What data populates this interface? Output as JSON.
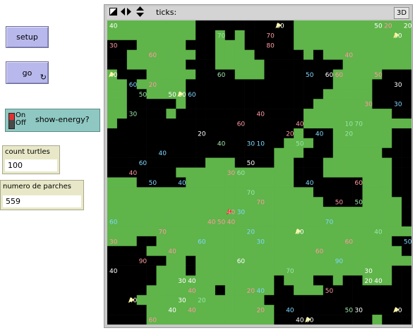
{
  "buttons": {
    "setup_label": "setup",
    "go_label": "go",
    "go_icon": "forever-arrows-icon"
  },
  "switch": {
    "on_label": "On",
    "off_label": "Off",
    "label": "show-energy?",
    "state": "off"
  },
  "monitors": [
    {
      "label": "count turtles",
      "value": "100"
    },
    {
      "label": "numero de parches",
      "value": "559"
    }
  ],
  "view": {
    "ticks_label": "ticks:",
    "ticks_value": "",
    "three_d_label": "3D",
    "world": {
      "grid_cols": 31,
      "grid_rows": 31,
      "green_patches": 559,
      "patch_colors": {
        "grass": "#5fb44a",
        "dirt": "#000000"
      },
      "turtles": [
        {
          "c": 0,
          "r": 0,
          "label": "40",
          "color": "#ffffff"
        },
        {
          "c": 17,
          "r": 0,
          "label": "80",
          "color": "#ffffff",
          "sheep": true
        },
        {
          "c": 27,
          "r": 0,
          "label": "50",
          "color": "#ffffff"
        },
        {
          "c": 28,
          "r": 0,
          "label": "20",
          "color": "#ff9aa2"
        },
        {
          "c": 30,
          "r": 0,
          "label": "20",
          "color": "#ffffff"
        },
        {
          "c": 0,
          "r": 2,
          "label": "30",
          "color": "#ff9aa2"
        },
        {
          "c": 11,
          "r": 1,
          "label": "70",
          "color": "#9ae6a8"
        },
        {
          "c": 16,
          "r": 1,
          "label": "70",
          "color": "#ff9aa2"
        },
        {
          "c": 16,
          "r": 2,
          "label": "80",
          "color": "#ff9aa2"
        },
        {
          "c": 29,
          "r": 1,
          "label": "30",
          "color": "#ffffff",
          "sheep": true
        },
        {
          "c": 4,
          "r": 3,
          "label": "60",
          "color": "#ff9aa2"
        },
        {
          "c": 24,
          "r": 3,
          "label": "40",
          "color": "#ff9aa2"
        },
        {
          "c": 0,
          "r": 5,
          "label": "40",
          "color": "#ffffff",
          "sheep": true
        },
        {
          "c": 11,
          "r": 5,
          "label": "60",
          "color": "#9ae6a8"
        },
        {
          "c": 20,
          "r": 5,
          "label": "50",
          "color": "#7fd8ff"
        },
        {
          "c": 22,
          "r": 5,
          "label": "60",
          "color": "#ffffff"
        },
        {
          "c": 23,
          "r": 5,
          "label": "60",
          "color": "#ff9aa2"
        },
        {
          "c": 27,
          "r": 5,
          "label": "50",
          "color": "#ff9aa2"
        },
        {
          "c": 2,
          "r": 6,
          "label": "60",
          "color": "#7fd8ff"
        },
        {
          "c": 4,
          "r": 6,
          "label": "20",
          "color": "#ff9aa2"
        },
        {
          "c": 29,
          "r": 6,
          "label": "30",
          "color": "#ffffff"
        },
        {
          "c": 3,
          "r": 7,
          "label": "50",
          "color": "#9ae6a8"
        },
        {
          "c": 6,
          "r": 7,
          "label": "50",
          "color": "#ffffff"
        },
        {
          "c": 7,
          "r": 7,
          "label": "80",
          "color": "#ffffff",
          "sheep": true
        },
        {
          "c": 8,
          "r": 7,
          "label": "60",
          "color": "#7fd8ff"
        },
        {
          "c": 26,
          "r": 8,
          "label": "30",
          "color": "#ff9aa2"
        },
        {
          "c": 29,
          "r": 8,
          "label": "30",
          "color": "#7fd8ff"
        },
        {
          "c": 2,
          "r": 9,
          "label": "30",
          "color": "#9ae6a8"
        },
        {
          "c": 15,
          "r": 9,
          "label": "40",
          "color": "#ff9aa2"
        },
        {
          "c": 13,
          "r": 10,
          "label": "60",
          "color": "#ff9aa2"
        },
        {
          "c": 9,
          "r": 11,
          "label": "20",
          "color": "#ffffff"
        },
        {
          "c": 19,
          "r": 10,
          "label": "40",
          "color": "#ff9aa2"
        },
        {
          "c": 18,
          "r": 11,
          "label": "20",
          "color": "#ff9aa2"
        },
        {
          "c": 21,
          "r": 11,
          "label": "40",
          "color": "#7fd8ff"
        },
        {
          "c": 24,
          "r": 10,
          "label": "10",
          "color": "#9ae6a8"
        },
        {
          "c": 25,
          "r": 10,
          "label": "70",
          "color": "#9ae6a8"
        },
        {
          "c": 24,
          "r": 11,
          "label": "20",
          "color": "#9ae6a8"
        },
        {
          "c": 11,
          "r": 12,
          "label": "40",
          "color": "#9ae6a8"
        },
        {
          "c": 14,
          "r": 12,
          "label": "30",
          "color": "#7fd8ff"
        },
        {
          "c": 15,
          "r": 12,
          "label": "10",
          "color": "#7fd8ff"
        },
        {
          "c": 19,
          "r": 12,
          "label": "50",
          "color": "#9ae6a8"
        },
        {
          "c": 5,
          "r": 13,
          "label": "40",
          "color": "#7fd8ff"
        },
        {
          "c": 14,
          "r": 14,
          "label": "50",
          "color": "#ffffff"
        },
        {
          "c": 3,
          "r": 14,
          "label": "60",
          "color": "#7fd8ff"
        },
        {
          "c": 12,
          "r": 15,
          "label": "30",
          "color": "#ff9aa2"
        },
        {
          "c": 13,
          "r": 15,
          "label": "60",
          "color": "#9ae6a8"
        },
        {
          "c": 2,
          "r": 15,
          "label": "40",
          "color": "#ff9aa2"
        },
        {
          "c": 7,
          "r": 16,
          "label": "40",
          "color": "#7fd8ff"
        },
        {
          "c": 20,
          "r": 16,
          "label": "40",
          "color": "#7fd8ff"
        },
        {
          "c": 25,
          "r": 16,
          "label": "60",
          "color": "#ff9aa2"
        },
        {
          "c": 4,
          "r": 16,
          "label": "50",
          "color": "#7fd8ff"
        },
        {
          "c": 14,
          "r": 17,
          "label": "70",
          "color": "#9ae6a8"
        },
        {
          "c": 23,
          "r": 18,
          "label": "50",
          "color": "#ff9aa2"
        },
        {
          "c": 25,
          "r": 18,
          "label": "50",
          "color": "#9ae6a8"
        },
        {
          "c": 15,
          "r": 18,
          "label": "70",
          "color": "#ff9aa2"
        },
        {
          "c": 13,
          "r": 19,
          "label": "30",
          "color": "#7fd8ff"
        },
        {
          "c": 12,
          "r": 19,
          "label": "40",
          "color": "#ff9aa2",
          "wolf": true
        },
        {
          "c": 10,
          "r": 20,
          "label": "40",
          "color": "#ff9aa2"
        },
        {
          "c": 11,
          "r": 20,
          "label": "50",
          "color": "#ff9aa2"
        },
        {
          "c": 12,
          "r": 20,
          "label": "40",
          "color": "#ff9aa2"
        },
        {
          "c": 22,
          "r": 20,
          "label": "70",
          "color": "#7fd8ff"
        },
        {
          "c": 0,
          "r": 20,
          "label": "60",
          "color": "#7fd8ff"
        },
        {
          "c": 19,
          "r": 21,
          "label": "80",
          "color": "#ffffff",
          "sheep": true
        },
        {
          "c": 14,
          "r": 21,
          "label": "20",
          "color": "#7fd8ff"
        },
        {
          "c": 27,
          "r": 21,
          "label": "40",
          "color": "#9ae6a8"
        },
        {
          "c": 5,
          "r": 21,
          "label": "70",
          "color": "#ff9aa2"
        },
        {
          "c": 15,
          "r": 22,
          "label": "30",
          "color": "#7fd8ff"
        },
        {
          "c": 9,
          "r": 22,
          "label": "60",
          "color": "#7fd8ff"
        },
        {
          "c": 30,
          "r": 22,
          "label": "50",
          "color": "#7fd8ff"
        },
        {
          "c": 0,
          "r": 22,
          "label": "30",
          "color": "#ff9aa2"
        },
        {
          "c": 6,
          "r": 23,
          "label": "40",
          "color": "#ff9aa2"
        },
        {
          "c": 21,
          "r": 23,
          "label": "60",
          "color": "#ff9aa2"
        },
        {
          "c": 24,
          "r": 22,
          "label": "60",
          "color": "#ff9aa2"
        },
        {
          "c": 3,
          "r": 24,
          "label": "90",
          "color": "#ff9aa2"
        },
        {
          "c": 13,
          "r": 24,
          "label": "60",
          "color": "#ffffff"
        },
        {
          "c": 23,
          "r": 24,
          "label": "90",
          "color": "#7fd8ff"
        },
        {
          "c": 0,
          "r": 25,
          "label": "40",
          "color": "#ffffff"
        },
        {
          "c": 18,
          "r": 25,
          "label": "70",
          "color": "#9ae6a8"
        },
        {
          "c": 26,
          "r": 25,
          "label": "30",
          "color": "#ffffff"
        },
        {
          "c": 27,
          "r": 26,
          "label": "40",
          "color": "#ffffff"
        },
        {
          "c": 26,
          "r": 26,
          "label": "20",
          "color": "#ffffff"
        },
        {
          "c": 7,
          "r": 26,
          "label": "30",
          "color": "#ffffff"
        },
        {
          "c": 8,
          "r": 26,
          "label": "40",
          "color": "#ffffff"
        },
        {
          "c": 8,
          "r": 27,
          "label": "40",
          "color": "#ff9aa2"
        },
        {
          "c": 22,
          "r": 27,
          "label": "50",
          "color": "#ff9aa2"
        },
        {
          "c": 14,
          "r": 27,
          "label": "20",
          "color": "#ff9aa2"
        },
        {
          "c": 15,
          "r": 27,
          "label": "40",
          "color": "#7fd8ff"
        },
        {
          "c": 2,
          "r": 28,
          "label": "40",
          "color": "#ffffff",
          "sheep": true
        },
        {
          "c": 7,
          "r": 28,
          "label": "30",
          "color": "#ffffff"
        },
        {
          "c": 9,
          "r": 28,
          "label": "20",
          "color": "#9ae6a8"
        },
        {
          "c": 8,
          "r": 29,
          "label": "40",
          "color": "#ff9aa2"
        },
        {
          "c": 6,
          "r": 29,
          "label": "40",
          "color": "#ffffff"
        },
        {
          "c": 15,
          "r": 29,
          "label": "20",
          "color": "#ff9aa2"
        },
        {
          "c": 18,
          "r": 29,
          "label": "40",
          "color": "#7fd8ff"
        },
        {
          "c": 25,
          "r": 29,
          "label": "30",
          "color": "#ffffff"
        },
        {
          "c": 29,
          "r": 29,
          "label": "40",
          "color": "#ffffff",
          "sheep": true
        },
        {
          "c": 19,
          "r": 30,
          "label": "40",
          "color": "#ffffff"
        },
        {
          "c": 20,
          "r": 30,
          "label": "80",
          "color": "#ffffff",
          "sheep": true
        },
        {
          "c": 4,
          "r": 30,
          "label": "60",
          "color": "#ff9aa2"
        },
        {
          "c": 24,
          "r": 29,
          "label": "50",
          "color": "#9ae6a8"
        }
      ]
    }
  }
}
